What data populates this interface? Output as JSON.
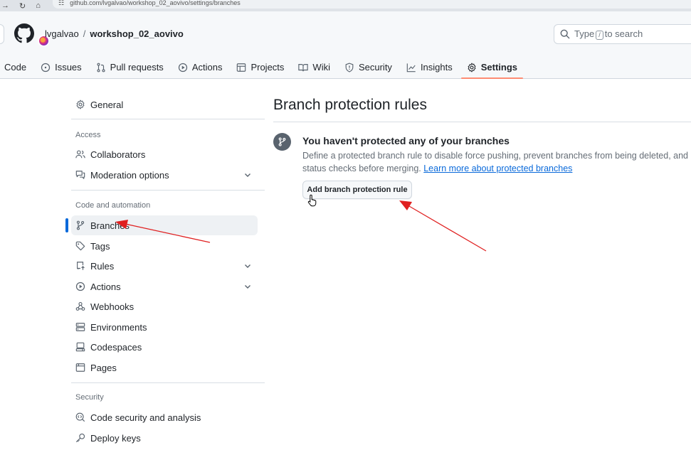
{
  "browser": {
    "url": "github.com/lvgalvao/workshop_02_aovivo/settings/branches"
  },
  "header": {
    "owner": "lvgalvao",
    "separator": "/",
    "repo": "workshop_02_aovivo",
    "search_prefix": "Type",
    "search_key": "/",
    "search_suffix": "to search"
  },
  "tabs": [
    {
      "label": "Code",
      "icon": "code-icon"
    },
    {
      "label": "Issues",
      "icon": "issue-opened-icon"
    },
    {
      "label": "Pull requests",
      "icon": "git-pull-request-icon"
    },
    {
      "label": "Actions",
      "icon": "play-icon"
    },
    {
      "label": "Projects",
      "icon": "table-icon"
    },
    {
      "label": "Wiki",
      "icon": "book-icon"
    },
    {
      "label": "Security",
      "icon": "shield-icon"
    },
    {
      "label": "Insights",
      "icon": "graph-icon"
    },
    {
      "label": "Settings",
      "icon": "gear-icon",
      "active": true
    }
  ],
  "sidebar": {
    "general": "General",
    "access_heading": "Access",
    "collaborators": "Collaborators",
    "moderation": "Moderation options",
    "code_heading": "Code and automation",
    "branches": "Branches",
    "tags": "Tags",
    "rules": "Rules",
    "actions": "Actions",
    "webhooks": "Webhooks",
    "environments": "Environments",
    "codespaces": "Codespaces",
    "pages": "Pages",
    "security_heading": "Security",
    "code_security": "Code security and analysis",
    "deploy_keys": "Deploy keys"
  },
  "main": {
    "title": "Branch protection rules",
    "blank_title": "You haven't protected any of your branches",
    "desc_line1": "Define a protected branch rule to disable force pushing, prevent branches from being deleted, and o",
    "desc_line2": "status checks before merging.",
    "learn_more": "Learn more about protected branches",
    "add_button": "Add branch protection rule"
  },
  "colors": {
    "accent_blue": "#0969da",
    "tab_underline": "#fd8c73",
    "annotation_arrow": "#e02020"
  }
}
